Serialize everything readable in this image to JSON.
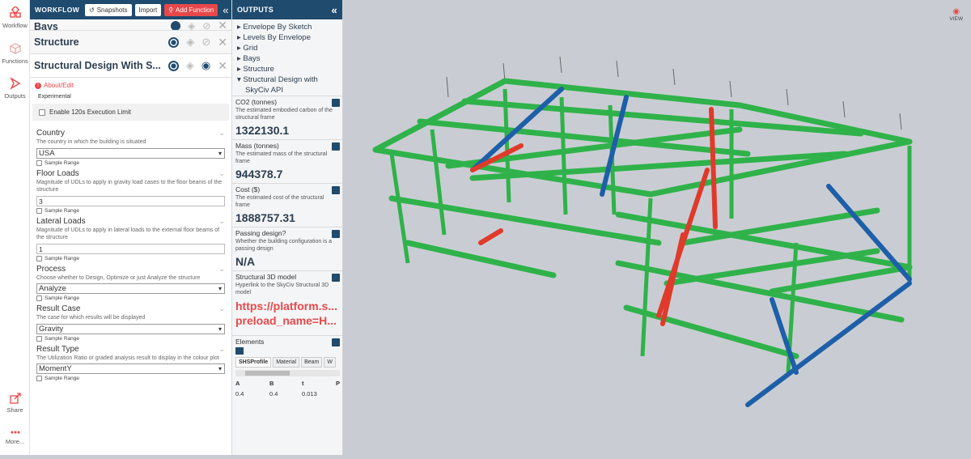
{
  "rail": {
    "workflow": "Workflow",
    "functions": "Functions",
    "outputs": "Outputs",
    "share": "Share",
    "more": "More..."
  },
  "workflow_panel": {
    "title": "WORKFLOW",
    "snapshots": "Snapshots",
    "import": "Import",
    "add_function": "Add Function",
    "rows": [
      {
        "name": "Bays"
      },
      {
        "name": "Structure"
      },
      {
        "name": "Structural Design With S..."
      }
    ],
    "about": "About/Edit",
    "experimental": "Experimental",
    "exec_limit": "Enable 120s Execution Limit",
    "sample_range": "Sample Range",
    "fields": {
      "country": {
        "label": "Country",
        "desc": "The country in which the building is situated",
        "value": "USA"
      },
      "floor": {
        "label": "Floor Loads",
        "desc": "Magnitude of UDLs to apply in gravity load cases to the floor beams of the structure",
        "value": "3"
      },
      "lateral": {
        "label": "Lateral Loads",
        "desc": "Magnitude of UDLs to apply in lateral loads to the external floor beams of the structure",
        "value": "1"
      },
      "process": {
        "label": "Process",
        "desc": "Choose whether to Design, Optimize or just Analyze the structure",
        "value": "Analyze"
      },
      "result_case": {
        "label": "Result Case",
        "desc": "The case for which results will be displayed",
        "value": "Gravity"
      },
      "result_type": {
        "label": "Result Type",
        "desc": "The Utilization Ratio or graded analysis result to display in the colour plot",
        "value": "MomentY"
      }
    }
  },
  "outputs_panel": {
    "title": "OUTPUTS",
    "tree": [
      "Envelope By Sketch",
      "Levels By Envelope",
      "Grid",
      "Bays",
      "Structure"
    ],
    "tree_open": [
      "Structural Design with",
      "SkyCiv API"
    ],
    "cards": {
      "co2": {
        "title": "CO2 (tonnes)",
        "desc": "The estimated embodied carbon of the structural frame",
        "value": "1322130.1"
      },
      "mass": {
        "title": "Mass (tonnes)",
        "desc": "The estimated mass of the structural frame",
        "value": "944378.7"
      },
      "cost": {
        "title": "Cost ($)",
        "desc": "The estimated cost of the structural frame",
        "value": "1888757.31"
      },
      "passing": {
        "title": "Passing design?",
        "desc": "Whether the building configuration is a passing design",
        "value": "N/A"
      },
      "model": {
        "title": "Structural 3D model",
        "desc": "Hyperlink to the SkyCiv Structural 3D model",
        "line1": "https://platform.s...",
        "line2": "preload_name=H..."
      }
    },
    "elements": {
      "title": "Elements",
      "tabs": [
        "SHSProfile",
        "Material",
        "Beam",
        "W"
      ],
      "columns": [
        "A",
        "B",
        "t",
        "P"
      ],
      "row": [
        "0.4",
        "0.4",
        "0.013",
        ""
      ]
    }
  },
  "viewport": {
    "view_label": "VIEW"
  },
  "colors": {
    "header": "#1f4b6e",
    "accent": "#e8484a",
    "beam_green": "#2fb24a",
    "beam_blue": "#1d5fa8",
    "beam_red": "#e03a2a"
  }
}
